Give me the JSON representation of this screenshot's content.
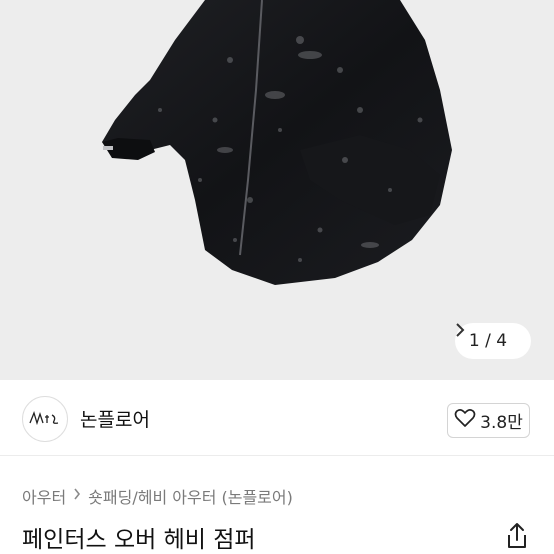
{
  "product": {
    "image_index": "1 / 4",
    "title": "페인터스 오버 헤비 점퍼"
  },
  "seller": {
    "name": "논플로어",
    "avatar_icon": "brand-logo-icon"
  },
  "likes": {
    "count": "3.8만",
    "icon": "heart-outline-icon"
  },
  "breadcrumb": {
    "category": "아우터",
    "subcategory": "숏패딩/헤비 아우터 (논플로어)"
  },
  "colors": {
    "hero_bg": "#ededed",
    "jacket": "#141518"
  }
}
